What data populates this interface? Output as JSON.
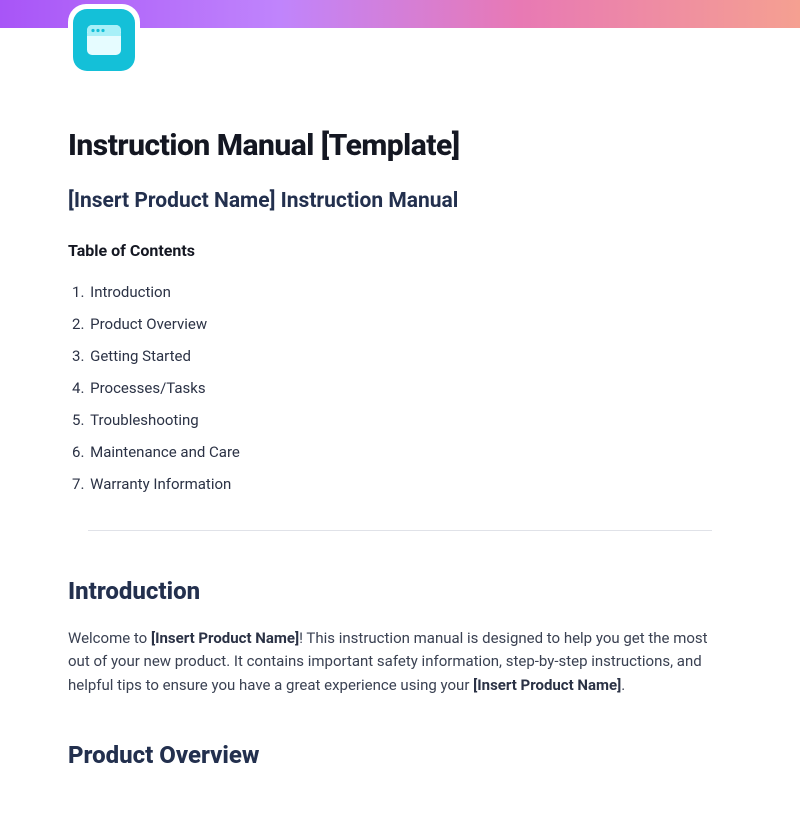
{
  "header": {
    "icon_name": "app-window-icon"
  },
  "title": "Instruction Manual [Template]",
  "subtitle": "[Insert Product Name] Instruction Manual",
  "toc": {
    "heading": "Table of Contents",
    "items": [
      "Introduction",
      "Product Overview",
      "Getting Started",
      "Processes/Tasks",
      "Troubleshooting",
      "Maintenance and Care",
      "Warranty Information"
    ]
  },
  "sections": {
    "introduction": {
      "heading": "Introduction",
      "text_prefix": "Welcome to ",
      "text_bold1": "[Insert Product Name]",
      "text_mid": "! This instruction manual is designed to help you get the most out of your new product. It contains important safety information, step-by-step instructions, and helpful tips to ensure you have a great experience using your ",
      "text_bold2": "[Insert Product Name]",
      "text_suffix": "."
    },
    "product_overview": {
      "heading": "Product Overview"
    }
  }
}
